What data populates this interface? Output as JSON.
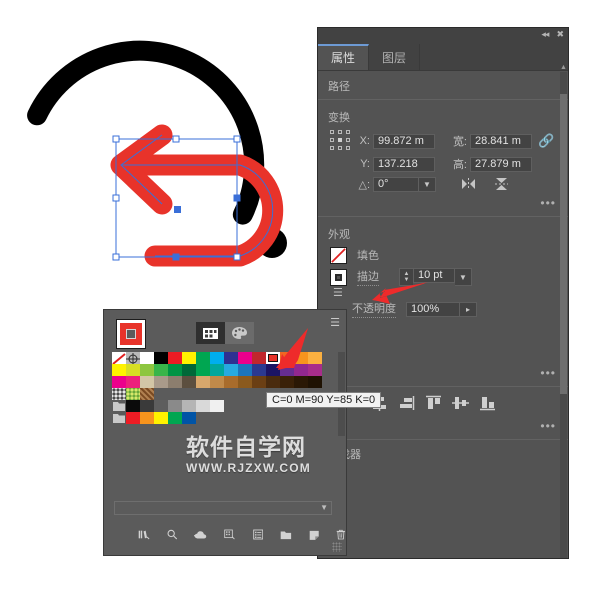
{
  "app": {
    "name": "Adobe Illustrator",
    "red_accent": "#e8332a",
    "panel_bg": "#535353"
  },
  "properties_panel": {
    "collapse_icon": "chevron-double-left-icon",
    "close_icon": "close-icon",
    "tabs": [
      {
        "label": "属性",
        "active": true
      },
      {
        "label": "图层",
        "active": false
      }
    ],
    "path_section": {
      "label": "路径"
    },
    "transform": {
      "label": "变换",
      "x": {
        "label": "X:",
        "value": "99.872 m"
      },
      "y": {
        "label": "Y:",
        "value": "137.218"
      },
      "width": {
        "label": "宽:",
        "value": "28.841 m"
      },
      "height": {
        "label": "高:",
        "value": "27.879 m"
      },
      "angle": {
        "label": "△:",
        "value": "0°"
      },
      "link_icon": "broken-link-icon",
      "flip_h_icon": "flip-horizontal-icon",
      "flip_v_icon": "flip-vertical-icon",
      "more_label": "•••"
    },
    "appearance": {
      "label": "外观",
      "fill": {
        "label": "填色",
        "value": "none",
        "swatch_icon": "no-color-icon"
      },
      "stroke": {
        "label": "描边",
        "weight": "10 pt",
        "swatch_icon": "stroke-square-icon"
      },
      "opacity": {
        "label": "不透明度",
        "value": "100%"
      },
      "more_label": "•••"
    },
    "align": {
      "icons": [
        "align-left-icon",
        "align-horizontal-center-icon",
        "align-right-icon",
        "align-top-icon",
        "align-vertical-center-icon",
        "align-bottom-icon"
      ],
      "more_label": "•••"
    },
    "pathfinder": {
      "label": "查找器"
    }
  },
  "swatches_panel": {
    "stroke_indicator": "stroke-color-indicator",
    "view_buttons": [
      {
        "name": "swatch-grid-view",
        "icon": "grid-view-icon",
        "active": true
      },
      {
        "name": "color-groups-view",
        "icon": "palette-icon",
        "active": false
      }
    ],
    "menu_icon": "panel-menu-icon",
    "selected_swatch": {
      "index": 12,
      "color": "#e8332a",
      "tooltip": "C=0 M=90 Y=85 K=0"
    },
    "rows": [
      [
        "none",
        "registration",
        "#ffffff",
        "#000000",
        "#ed1c24",
        "#fff200",
        "#00a651",
        "#00aeef",
        "#2e3192",
        "#ec008c",
        "#c1272d",
        "#e8332a",
        "#f26522",
        "#f7941d",
        "#fbb040"
      ],
      [
        "#fff200",
        "#d7df23",
        "#8dc63f",
        "#39b54a",
        "#009444",
        "#006838",
        "#00a651",
        "#00a79d",
        "#27aae1",
        "#1c75bc",
        "#2b3990",
        "#1b1464",
        "#662d91",
        "#92278f",
        "#a82d8b"
      ],
      [
        "#ec008c",
        "#ed217c",
        "#d3c6a6",
        "#a99a8a",
        "#8c7e6e",
        "#5c4f3f",
        "#d7a76c",
        "#c08a4a",
        "#a86c2c",
        "#8b5a1e",
        "#6b3f14",
        "#4a2b0e",
        "#3a2108",
        "#2a1805",
        "#1f1203"
      ],
      [
        "pattern-dots",
        "pattern-green",
        "pattern-wood"
      ],
      [
        "folder",
        "#0b0b0b",
        "#3a3a3a",
        "#5e5e5e",
        "#8a8a8a",
        "#b5b5b5",
        "#d9d9d9",
        "#f0f0f0"
      ],
      [
        "folder",
        "#ed1c24",
        "#f7941d",
        "#fff200",
        "#00a651",
        "#0054a6"
      ]
    ],
    "bottom_icons": [
      "swatch-libraries-icon",
      "show-swatch-kinds-icon",
      "libraries-cloud-icon",
      "swatch-options-grid-icon",
      "swatch-options-list-icon",
      "new-color-group-icon",
      "new-swatch-icon",
      "delete-swatch-icon"
    ]
  },
  "artwork": {
    "shape_name": "undo-arrow-path",
    "stroke_color": "#e8332a",
    "backdrop_name": "black-circle-arc-graphic",
    "selection": {
      "visible": true,
      "handle_color": "#3a6fd8",
      "anchor_count": 8,
      "center_point": true
    }
  },
  "annotations": {
    "arrow_to_stroke": "red-arrow-pointing-to-stroke",
    "arrow_to_swatch": "red-arrow-pointing-to-red-swatch"
  },
  "watermark": {
    "title": "软件自学网",
    "url": "WWW.RJZXW.COM"
  }
}
